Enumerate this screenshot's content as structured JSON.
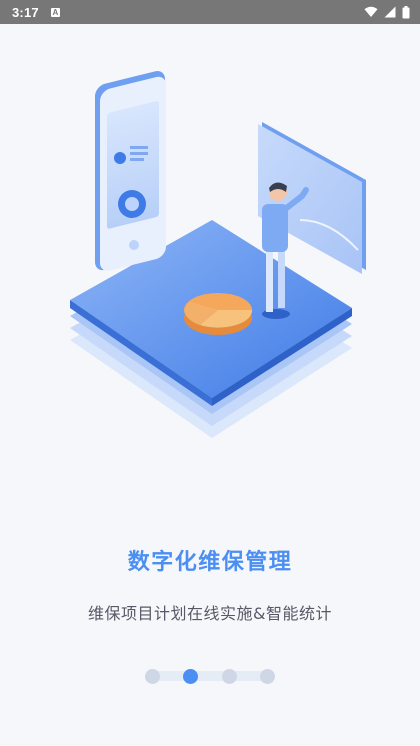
{
  "status_bar": {
    "time": "3:17",
    "left_icon": "A",
    "icons": [
      "wifi-icon",
      "signal-icon",
      "battery-icon"
    ]
  },
  "onboarding": {
    "title": "数字化维保管理",
    "subtitle": "维保项目计划在线实施&智能统计",
    "page_indicator": {
      "count": 4,
      "active_index": 1
    }
  },
  "colors": {
    "accent": "#4b8ff2",
    "inactive_dot": "#cfd7e6",
    "background": "#f6f7fb"
  }
}
